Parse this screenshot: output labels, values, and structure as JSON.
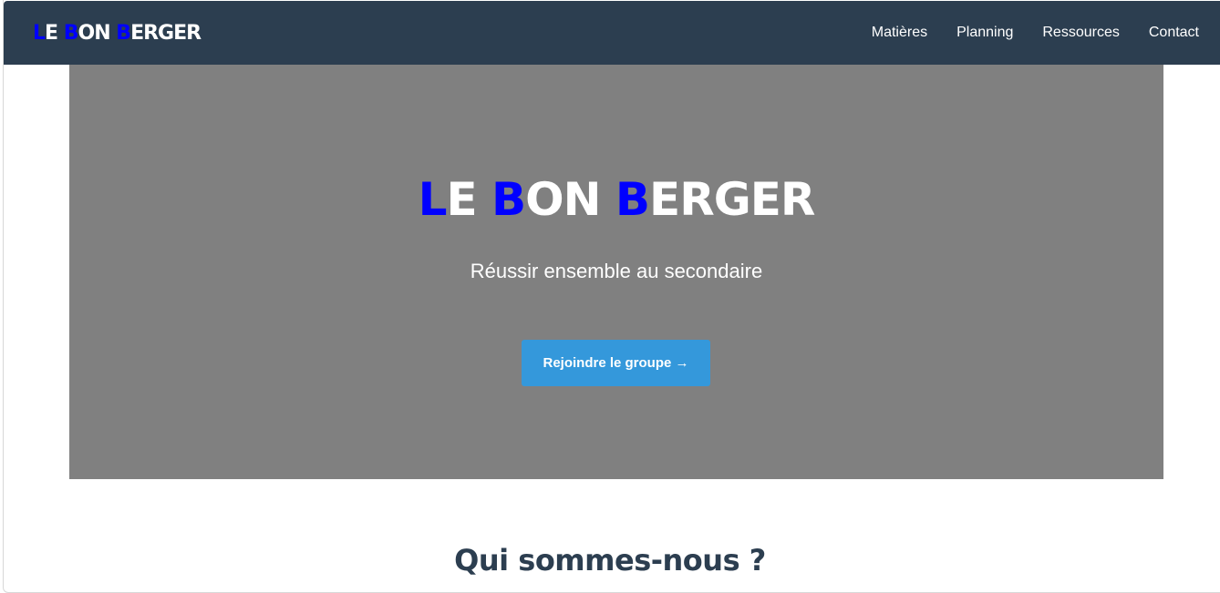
{
  "nav": {
    "brand": [
      {
        "text": "L",
        "accent": true
      },
      {
        "text": "E ",
        "accent": false
      },
      {
        "text": "B",
        "accent": true
      },
      {
        "text": "ON ",
        "accent": false
      },
      {
        "text": "B",
        "accent": true
      },
      {
        "text": "ERGER",
        "accent": false
      }
    ],
    "links": [
      "Matières",
      "Planning",
      "Ressources",
      "Contact"
    ]
  },
  "hero": {
    "title": [
      {
        "text": "L",
        "accent": true
      },
      {
        "text": "E ",
        "accent": false
      },
      {
        "text": "B",
        "accent": true
      },
      {
        "text": "ON ",
        "accent": false
      },
      {
        "text": "B",
        "accent": true
      },
      {
        "text": "ERGER",
        "accent": false
      }
    ],
    "subtitle": "Réussir ensemble au secondaire",
    "cta_label": "Rejoindre le groupe →"
  },
  "about": {
    "title": "Qui sommes-nous ?"
  },
  "colors": {
    "navbar": "#2c3e50",
    "accent_letters": "#0000ff",
    "hero_background": "#808080",
    "cta_button": "#3498db",
    "section_title": "#2c3e50"
  }
}
